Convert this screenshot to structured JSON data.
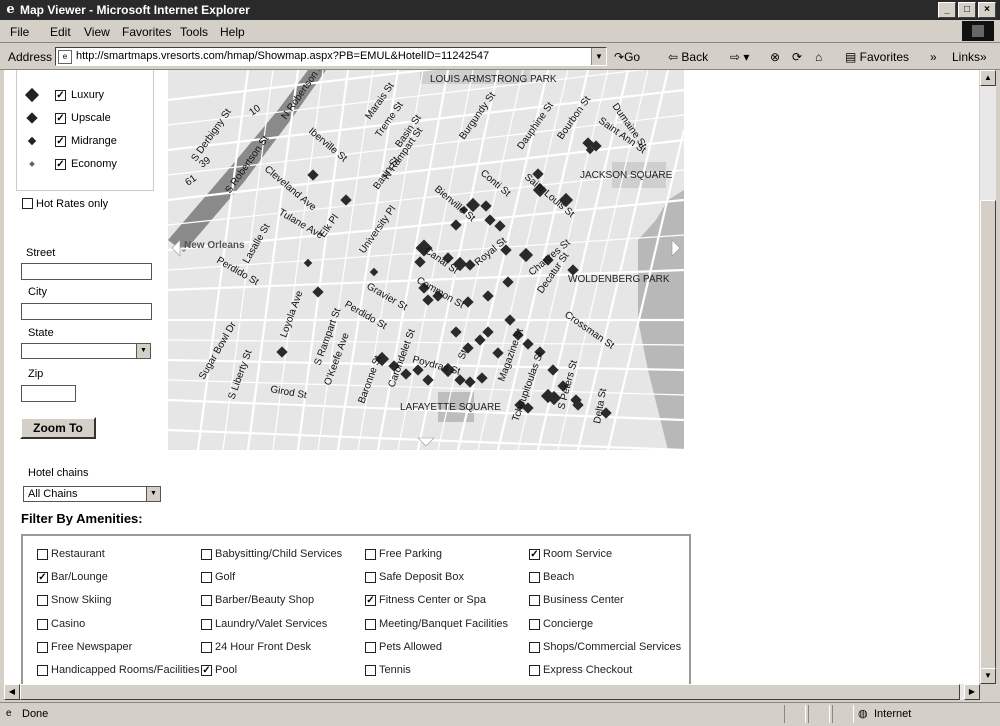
{
  "window": {
    "title": "Map Viewer - Microsoft Internet Explorer"
  },
  "menu": [
    "File",
    "Edit",
    "View",
    "Favorites",
    "Tools",
    "Help"
  ],
  "address": {
    "label": "Address",
    "url": "http://smartmaps.vresorts.com/hmap/Showmap.aspx?PB=EMUL&HotelID=11242547"
  },
  "toolbar": {
    "go": "Go",
    "back": "Back",
    "favorites": "Favorites",
    "links": "Links",
    "more": "»"
  },
  "legend": {
    "items": [
      {
        "label": "Luxury",
        "checked": true
      },
      {
        "label": "Upscale",
        "checked": true
      },
      {
        "label": "Midrange",
        "checked": true
      },
      {
        "label": "Economy",
        "checked": true
      }
    ],
    "hot_rates": {
      "label": "Hot Rates only",
      "checked": false
    }
  },
  "search": {
    "street_label": "Street",
    "street_value": "",
    "city_label": "City",
    "city_value": "",
    "state_label": "State",
    "state_value": "",
    "zip_label": "Zip",
    "zip_value": "",
    "zoom_button": "Zoom To"
  },
  "chains": {
    "label": "Hotel chains",
    "selected": "All Chains"
  },
  "map": {
    "places": [
      "LOUIS ARMSTRONG PARK",
      "JACKSON SQUARE",
      "WOLDENBERG PARK",
      "LAFAYETTE SQUARE",
      "New Orleans"
    ],
    "streets": [
      "N Robertson St",
      "Marais St",
      "Treme St",
      "Basin St",
      "Burgundy St",
      "Dauphine St",
      "Bourbon St",
      "Dumaine St",
      "Saint Ann St",
      "S Derbigny St",
      "10",
      "39",
      "61",
      "S Robertson St",
      "N Rampart St",
      "Iberville St",
      "Basin St",
      "Conti St",
      "Saint Louis St",
      "Cleveland Ave",
      "Bienville St",
      "Elk Pl",
      "Tulane Ave",
      "University Pl",
      "Royal St",
      "Chartres St",
      "Lasalle St",
      "Perdido St",
      "Canal St",
      "Decatur St",
      "Loyola Ave",
      "Gravier St",
      "Perdido St",
      "S Rampart St",
      "Common St",
      "Crossman St",
      "Sugar Bowl Dr",
      "S Liberty St",
      "O'Keefe Ave",
      "Baronne St",
      "Carondelet St",
      "Poydras St",
      "St",
      "Magazine St",
      "Tchoupitoulas St",
      "S Peters St",
      "Girod St",
      "Delta St"
    ]
  },
  "amenities_title": "Filter By Amenities:",
  "amenities": [
    {
      "label": "Restaurant",
      "checked": false
    },
    {
      "label": "Babysitting/Child Services",
      "checked": false
    },
    {
      "label": "Free Parking",
      "checked": false
    },
    {
      "label": "Room Service",
      "checked": true
    },
    {
      "label": "Bar/Lounge",
      "checked": true
    },
    {
      "label": "Golf",
      "checked": false
    },
    {
      "label": "Safe Deposit Box",
      "checked": false
    },
    {
      "label": "Beach",
      "checked": false
    },
    {
      "label": "Snow Skiing",
      "checked": false
    },
    {
      "label": "Barber/Beauty Shop",
      "checked": false
    },
    {
      "label": "Fitness Center or Spa",
      "checked": true
    },
    {
      "label": "Business Center",
      "checked": false
    },
    {
      "label": "Casino",
      "checked": false
    },
    {
      "label": "Laundry/Valet Services",
      "checked": false
    },
    {
      "label": "Meeting/Banquet Facilities",
      "checked": false
    },
    {
      "label": "Concierge",
      "checked": false
    },
    {
      "label": "Free Newspaper",
      "checked": false
    },
    {
      "label": "24 Hour Front Desk",
      "checked": false
    },
    {
      "label": "Pets Allowed",
      "checked": false
    },
    {
      "label": "Shops/Commercial Services",
      "checked": false
    },
    {
      "label": "Handicapped Rooms/Facilities",
      "checked": false
    },
    {
      "label": "Pool",
      "checked": true
    },
    {
      "label": "Tennis",
      "checked": false
    },
    {
      "label": "Express Checkout",
      "checked": false
    }
  ],
  "status": {
    "left": "Done",
    "zone": "Internet"
  }
}
